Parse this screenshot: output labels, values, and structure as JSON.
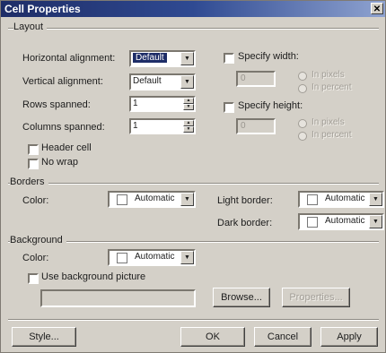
{
  "window": {
    "title": "Cell Properties",
    "close_glyph": "✕"
  },
  "layout": {
    "group_label": "Layout",
    "horizontal_alignment": {
      "label": "Horizontal alignment:",
      "value": "Default"
    },
    "vertical_alignment": {
      "label": "Vertical alignment:",
      "value": "Default"
    },
    "rows_spanned": {
      "label": "Rows spanned:",
      "value": "1"
    },
    "columns_spanned": {
      "label": "Columns spanned:",
      "value": "1"
    },
    "header_cell": {
      "label": "Header cell",
      "checked": false
    },
    "no_wrap": {
      "label": "No wrap",
      "checked": false
    },
    "specify_width": {
      "label": "Specify width:",
      "checked": false,
      "value": "0"
    },
    "specify_height": {
      "label": "Specify height:",
      "checked": false,
      "value": "0"
    },
    "width_units": [
      "In pixels",
      "In percent"
    ],
    "height_units": [
      "In pixels",
      "In percent"
    ]
  },
  "borders": {
    "group_label": "Borders",
    "color_label": "Color:",
    "color_value": "Automatic",
    "light_border_label": "Light border:",
    "light_border_value": "Automatic",
    "dark_border_label": "Dark border:",
    "dark_border_value": "Automatic"
  },
  "background": {
    "group_label": "Background",
    "color_label": "Color:",
    "color_value": "Automatic",
    "use_picture_label": "Use background picture",
    "picture_path": "",
    "browse_label": "Browse...",
    "properties_label": "Properties..."
  },
  "footer": {
    "style_label": "Style...",
    "ok_label": "OK",
    "cancel_label": "Cancel",
    "apply_label": "Apply"
  },
  "colors": {
    "title_start": "#1e2d67",
    "title_end": "#8fa3d0",
    "dialog_bg": "#d4d0c8"
  }
}
